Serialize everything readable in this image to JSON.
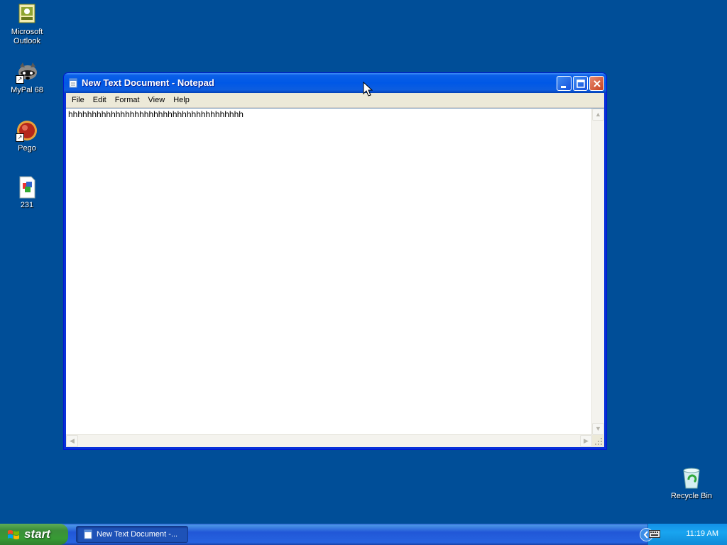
{
  "desktop": {
    "icons": [
      {
        "label": "Microsoft Outlook",
        "icon": "outlook-icon"
      },
      {
        "label": "MyPal 68",
        "icon": "raccoon-icon"
      },
      {
        "label": "Pego",
        "icon": "pego-icon"
      },
      {
        "label": "231",
        "icon": "document-icon"
      },
      {
        "label": "Recycle Bin",
        "icon": "recycle-bin-icon"
      }
    ],
    "background_color": "#004e98"
  },
  "window": {
    "title": "New Text Document - Notepad",
    "menu": [
      "File",
      "Edit",
      "Format",
      "View",
      "Help"
    ],
    "content": "hhhhhhhhhhhhhhhhhhhhhhhhhhhhhhhhhhhhh"
  },
  "taskbar": {
    "start_label": "start",
    "task_label": "New Text Document -...",
    "clock": "11:19 AM"
  },
  "colors": {
    "titlebar": "#0058e6",
    "start": "#379a34",
    "tray": "#19a5f0"
  }
}
